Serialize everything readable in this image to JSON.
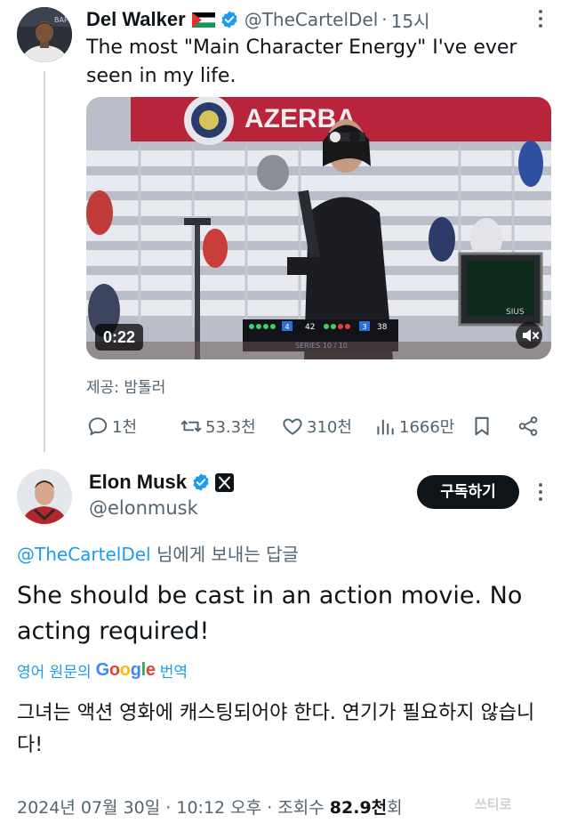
{
  "tweet": {
    "author": {
      "name": "Del Walker",
      "handle": "@TheCartelDel",
      "time": "15시",
      "avatar_icon": "avatar-photo"
    },
    "text": "The most \"Main Character Energy\" I've ever seen in my life.",
    "media": {
      "duration": "0:22",
      "banner_text": "AZERBA",
      "scoreboard": {
        "left_score": "42",
        "left_set": "4",
        "right_score": "38",
        "right_set": "3",
        "series": "SERIES 10 / 10",
        "monitor_brand": "SIUS"
      }
    },
    "caption": "제공: 밤톨러",
    "stats": {
      "replies": "1천",
      "retweets": "53.3천",
      "likes": "310천",
      "views": "1666만"
    }
  },
  "reply": {
    "author": {
      "name": "Elon Musk",
      "handle": "@elonmusk"
    },
    "subscribe_label": "구독하기",
    "replying_to_handle": "@TheCartelDel",
    "replying_to_suffix": " 님에게 보내는 답글",
    "text": "She should be cast in an action movie. No acting required!",
    "translate": {
      "prefix": "영어 원문의",
      "brand": "Google",
      "suffix": "번역"
    },
    "translation": "그녀는 액션 영화에 캐스팅되어야 한다. 연기가 필요하지 않습니다!",
    "meta": {
      "date": "2024년 07월 30일",
      "time": "10:12 오후",
      "views_label": "조회수",
      "views_value": "82.9천",
      "views_unit": "회"
    }
  },
  "watermark": "쓰티로",
  "colors": {
    "accent": "#1d9bf0",
    "text": "#0f1419",
    "muted": "#536471",
    "google_blue": "#4285f4",
    "google_red": "#ea4335",
    "google_yellow": "#fbbc05",
    "google_green": "#34a853"
  }
}
